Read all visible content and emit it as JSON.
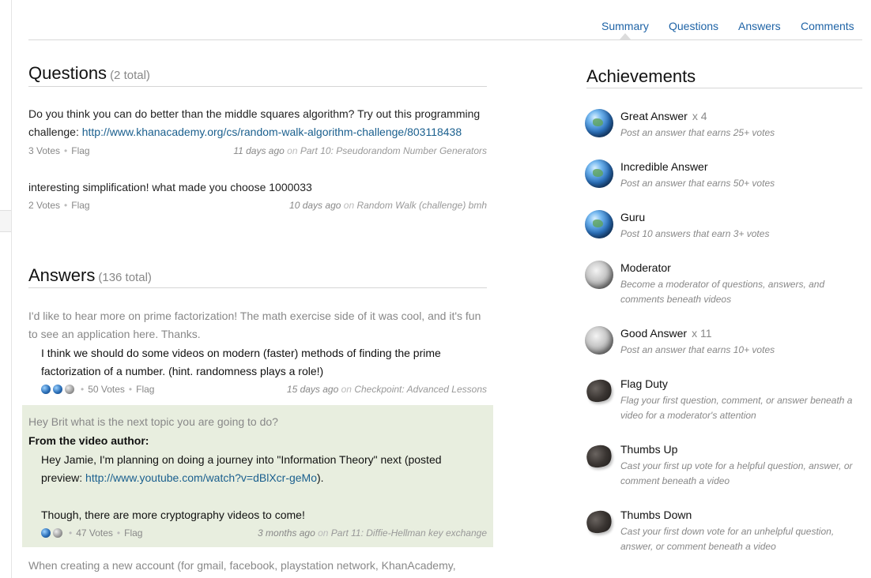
{
  "tabs": [
    "Summary",
    "Questions",
    "Answers",
    "Comments"
  ],
  "questions": {
    "title": "Questions",
    "total": "(2 total)",
    "items": [
      {
        "text_before": "Do you think you can do better than the middle squares algorithm? Try out this programming challenge: ",
        "link": "http://www.khanacademy.org/cs/random-walk-algorithm-challenge/803118438",
        "votes": "3 Votes",
        "flag": "Flag",
        "when": "11 days ago",
        "on": "on",
        "where": "Part 10: Pseudorandom Number Generators"
      },
      {
        "text": "interesting simplification! what made you choose 1000033",
        "votes": "2 Votes",
        "flag": "Flag",
        "when": "10 days ago",
        "on": "on",
        "where": "Random Walk (challenge) bmh"
      }
    ]
  },
  "answers": {
    "title": "Answers",
    "total": "(136 total)",
    "items": [
      {
        "question": "I'd like to hear more on prime factorization! The math exercise side of it was cool, and it's fun to see an application here. Thanks.",
        "answer": "I think we should do some videos on modern (faster) methods of finding the prime factorization of a number. (hint. randomness plays a role!)",
        "badges": [
          "earth",
          "earth",
          "moon"
        ],
        "votes": "50 Votes",
        "flag": "Flag",
        "when": "15 days ago",
        "on": "on",
        "where": "Checkpoint: Advanced Lessons"
      },
      {
        "question": "Hey Brit what is the next topic you are going to do?",
        "author_label": "From the video author:",
        "answer_before": "Hey Jamie, I'm planning on doing a journey into \"Information Theory\" next (posted preview: ",
        "answer_link": "http://www.youtube.com/watch?v=dBlXcr-geMo",
        "answer_after": ").",
        "answer_p2": "Though, there are more cryptography videos to come!",
        "badges": [
          "earth",
          "moon"
        ],
        "votes": "47 Votes",
        "flag": "Flag",
        "when": "3 months ago",
        "on": "on",
        "where": "Part 11: Diffie-Hellman key exchange"
      },
      {
        "question": "When creating a new account (for gmail, facebook, playstation network, KhanAcademy,"
      }
    ]
  },
  "achievements": {
    "title": "Achievements",
    "items": [
      {
        "icon": "earth",
        "title": "Great Answer",
        "count": "x 4",
        "desc": "Post an answer that earns 25+ votes"
      },
      {
        "icon": "earth",
        "title": "Incredible Answer",
        "count": "",
        "desc": "Post an answer that earns 50+ votes"
      },
      {
        "icon": "earth",
        "title": "Guru",
        "count": "",
        "desc": "Post 10 answers that earn 3+ votes"
      },
      {
        "icon": "moon",
        "title": "Moderator",
        "count": "",
        "desc": "Become a moderator of questions, answers, and comments beneath videos"
      },
      {
        "icon": "moon",
        "title": "Good Answer",
        "count": "x 11",
        "desc": "Post an answer that earns 10+ votes"
      },
      {
        "icon": "rock",
        "title": "Flag Duty",
        "count": "",
        "desc": "Flag your first question, comment, or answer beneath a video for a moderator's attention"
      },
      {
        "icon": "rock",
        "title": "Thumbs Up",
        "count": "",
        "desc": "Cast your first up vote for a helpful question, answer, or comment beneath a video"
      },
      {
        "icon": "rock",
        "title": "Thumbs Down",
        "count": "",
        "desc": "Cast your first down vote for an unhelpful question, answer, or comment beneath a video"
      }
    ]
  }
}
